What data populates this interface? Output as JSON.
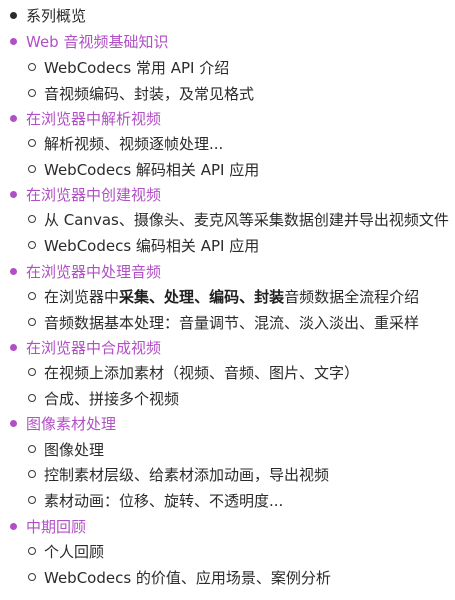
{
  "sections": [
    {
      "title": "系列概览",
      "link": false,
      "items": []
    },
    {
      "title": "Web 音视频基础知识",
      "link": true,
      "items": [
        {
          "text": "WebCodecs 常用 API 介绍"
        },
        {
          "text": "音视频编码、封装，及常见格式"
        }
      ]
    },
    {
      "title": "在浏览器中解析视频",
      "link": true,
      "items": [
        {
          "text": "解析视频、视频逐帧处理..."
        },
        {
          "text": "WebCodecs 解码相关 API 应用"
        }
      ]
    },
    {
      "title": "在浏览器中创建视频",
      "link": true,
      "items": [
        {
          "text": "从 Canvas、摄像头、麦克风等采集数据创建并导出视频文件"
        },
        {
          "text": "WebCodecs 编码相关 API 应用"
        }
      ]
    },
    {
      "title": "在浏览器中处理音频",
      "link": true,
      "items": [
        {
          "text_parts": [
            "在浏览器中",
            "采集",
            "、",
            "处理",
            "、",
            "编码",
            "、",
            "封装",
            "音频数据全流程介绍"
          ]
        },
        {
          "text": "音频数据基本处理：音量调节、混流、淡入淡出、重采样"
        }
      ]
    },
    {
      "title": "在浏览器中合成视频",
      "link": true,
      "items": [
        {
          "text": "在视频上添加素材（视频、音频、图片、文字）"
        },
        {
          "text": "合成、拼接多个视频"
        }
      ]
    },
    {
      "title": "图像素材处理",
      "link": true,
      "items": [
        {
          "text": "图像处理"
        },
        {
          "text": "控制素材层级、给素材添加动画，导出视频"
        },
        {
          "text": "素材动画：位移、旋转、不透明度..."
        }
      ]
    },
    {
      "title": "中期回顾",
      "link": true,
      "items": [
        {
          "text": "个人回顾"
        },
        {
          "text": "WebCodecs 的价值、应用场景、案例分析"
        }
      ]
    }
  ],
  "colors": {
    "accent": "#b24fc6",
    "text": "#2b2b2b"
  }
}
